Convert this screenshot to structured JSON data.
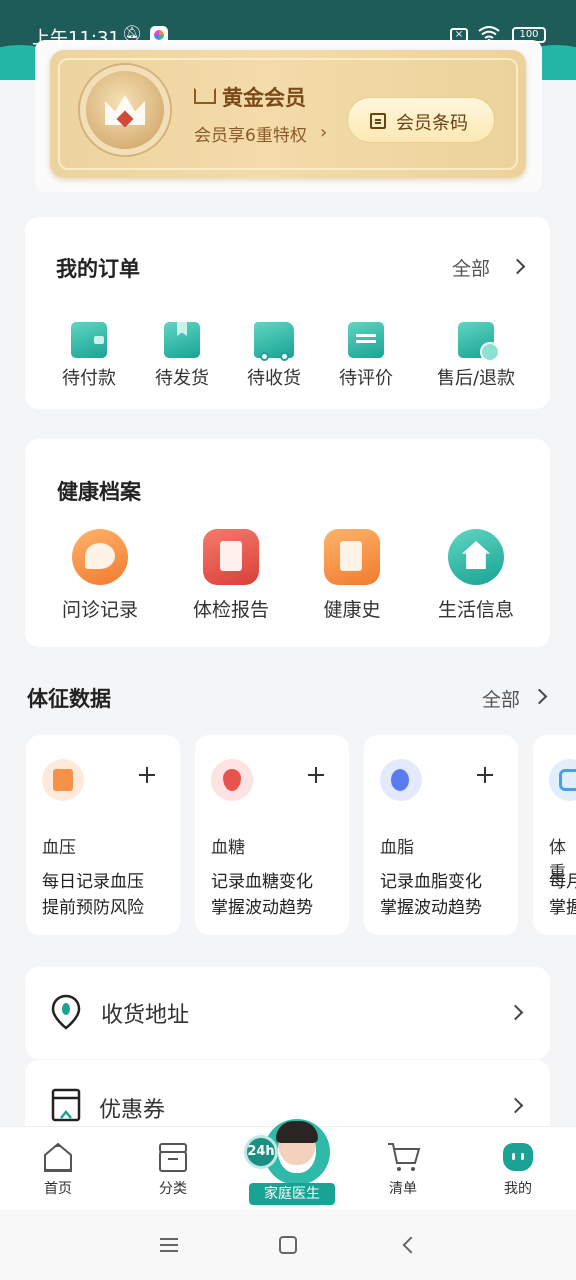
{
  "status_bar": {
    "time": "上午11:31",
    "battery": "100"
  },
  "member": {
    "title": "黄金会员",
    "subtitle": "会员享6重特权",
    "barcode_button": "会员条码"
  },
  "orders": {
    "title": "我的订单",
    "all": "全部",
    "items": [
      {
        "label": "待付款",
        "icon": "wallet-icon"
      },
      {
        "label": "待发货",
        "icon": "box-icon"
      },
      {
        "label": "待收货",
        "icon": "truck-icon"
      },
      {
        "label": "待评价",
        "icon": "comment-icon"
      },
      {
        "label": "售后/退款",
        "icon": "refund-icon"
      }
    ]
  },
  "health": {
    "title": "健康档案",
    "items": [
      {
        "label": "问诊记录",
        "icon": "consult-icon",
        "color": "#f5924a"
      },
      {
        "label": "体检报告",
        "icon": "report-icon",
        "color": "#e8544d"
      },
      {
        "label": "健康史",
        "icon": "history-icon",
        "color": "#f5924a"
      },
      {
        "label": "生活信息",
        "icon": "home-icon",
        "color": "#2fb9a8"
      }
    ]
  },
  "vitals": {
    "title": "体征数据",
    "all": "全部",
    "items": [
      {
        "name": "血压",
        "line1": "每日记录血压",
        "line2": "提前预防风险",
        "icon": "blood-pressure-icon",
        "color": "#f5924a"
      },
      {
        "name": "血糖",
        "line1": "记录血糖变化",
        "line2": "掌握波动趋势",
        "icon": "blood-sugar-icon",
        "color": "#e8544d"
      },
      {
        "name": "血脂",
        "line1": "记录血脂变化",
        "line2": "掌握波动趋势",
        "icon": "blood-lipid-icon",
        "color": "#5b7cf0"
      },
      {
        "name": "体重",
        "line1": "每月",
        "line2": "掌握",
        "icon": "weight-icon",
        "color": "#4a9ee8"
      }
    ]
  },
  "rows": [
    {
      "label": "收货地址",
      "icon": "location-icon"
    },
    {
      "label": "优惠券",
      "icon": "coupon-icon"
    }
  ],
  "bottom_nav": {
    "items": [
      {
        "label": "首页",
        "icon": "home-nav-icon"
      },
      {
        "label": "分类",
        "icon": "category-icon"
      },
      {
        "label": "清单",
        "icon": "cart-icon"
      },
      {
        "label": "我的",
        "icon": "profile-icon",
        "active": true
      }
    ],
    "doctor_badge": "24h",
    "doctor_label": "家庭医生"
  },
  "colors": {
    "accent": "#1aa294",
    "gold": "#ecd39f"
  }
}
